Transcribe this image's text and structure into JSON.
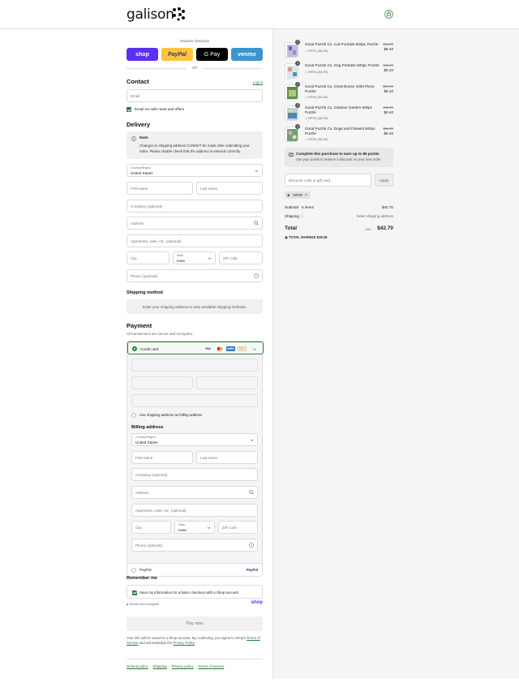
{
  "header": {
    "logo": "galison",
    "bag_icon": "bag-icon"
  },
  "express": {
    "label": "Express checkout",
    "buttons": [
      {
        "label": "shop",
        "bg": "#5a31f4",
        "fg": "#ffffff"
      },
      {
        "label": "PayPal",
        "bg": "#ffc439",
        "fg": "#253b80"
      },
      {
        "label": "G Pay",
        "bg": "#000000",
        "fg": "#ffffff"
      },
      {
        "label": "venmo",
        "bg": "#3d95ce",
        "fg": "#ffffff"
      }
    ],
    "or": "OR"
  },
  "contact": {
    "title": "Contact",
    "login": "Log in",
    "email_placeholder": "Email",
    "news_label": "Email me with news and offers"
  },
  "delivery": {
    "title": "Delivery",
    "note_title": "Note",
    "note_body": "Changes to shipping address CANNOT be made after submitting your order. Please double check that the address is entered correctly.",
    "country_label": "Country/Region",
    "country_value": "United States",
    "first_name": "First name",
    "last_name": "Last name",
    "company": "Company (optional)",
    "address": "Address",
    "apartment": "Apartment, suite, etc. (optional)",
    "city": "City",
    "state_label": "State",
    "state_value": "Iowa",
    "zip": "ZIP code",
    "phone": "Phone (optional)"
  },
  "shipping": {
    "title": "Shipping method",
    "message": "Enter your shipping address to view available shipping methods."
  },
  "payment": {
    "title": "Payment",
    "subtitle": "All transactions are secure and encrypted.",
    "credit_card": "Credit card",
    "card_logos": [
      "VISA",
      "MC",
      "AMEX",
      "DISC"
    ],
    "more_cards": "+5",
    "use_shipping": "Use shipping address as billing address",
    "billing_title": "Billing address",
    "paypal": "PayPal",
    "paypal_logo": "PayPal"
  },
  "remember": {
    "title": "Remember me",
    "save_label": "Save my information for a faster checkout with a Shop account",
    "secure": "Secure and encrypted",
    "shop": "shop"
  },
  "pay_now": "Pay now",
  "legal": {
    "pre": "Your info will be saved to a Shop account. By continuing, you agree to Shop's",
    "terms": "Terms of Service",
    "mid": "and acknowledge the",
    "privacy": "Privacy Policy",
    "end": "."
  },
  "footer_links": [
    "Refund policy",
    "Shipping",
    "Privacy policy",
    "Terms of service"
  ],
  "cart": {
    "items": [
      {
        "qty": "1",
        "name": "Good Puzzle Co. Cat Portraits 500pc Puzzle",
        "discount": "VIP30 (-$3.59)",
        "old_price": "$11.99",
        "price": "$8.40"
      },
      {
        "qty": "1",
        "name": "Good Puzzle Co. Dog Portraits 500pc Puzzle",
        "discount": "VIP30 (-$3.59)",
        "old_price": "$11.99",
        "price": "$8.40"
      },
      {
        "qty": "1",
        "name": "Good Puzzle Co. Greenhouse 1000 Piece Puzzle",
        "discount": "VIP30 (-$3.89)",
        "old_price": "$12.99",
        "price": "$9.10"
      },
      {
        "qty": "1",
        "name": "Good Puzzle Co. Outdoor Garden 500pc Puzzle",
        "discount": "VIP30 (-$3.59)",
        "old_price": "$11.99",
        "price": "$8.40"
      },
      {
        "qty": "1",
        "name": "Good Puzzle Co. Dogs and Flowers 500pc Puzzle",
        "discount": "VIP30 (-$3.59)",
        "old_price": "$11.99",
        "price": "$8.40"
      }
    ],
    "points_title": "Complete this purchase to earn up to 85 points",
    "points_sub": "Use your points to redeem a discount on your next order",
    "discount_placeholder": "Discount code or gift card",
    "apply": "Apply",
    "applied_code": "VIP30",
    "subtotal_label": "Subtotal · 5 items",
    "subtotal": "$42.70",
    "shipping_label": "Shipping",
    "shipping_value": "Enter shipping address",
    "total_label": "Total",
    "currency": "USD",
    "total": "$42.70",
    "savings_label": "TOTAL SAVINGS",
    "savings": "$18.25"
  },
  "colors": {
    "accent": "#2a7a3a",
    "panel": "#f5f5f5"
  }
}
